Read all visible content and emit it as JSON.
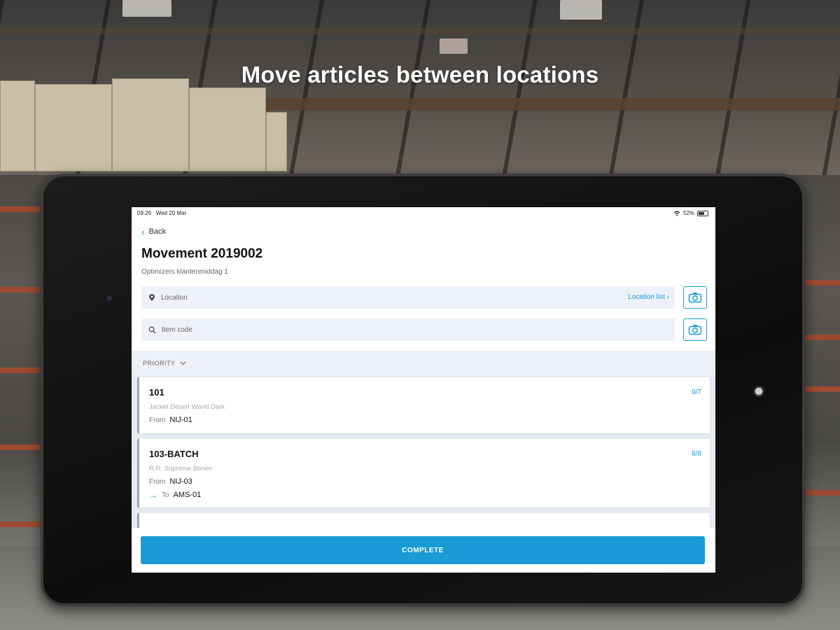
{
  "headline": "Move articles between locations",
  "status": {
    "time": "09:26",
    "date": "Wed 20 Mar",
    "battery": "52%"
  },
  "nav": {
    "back_label": "Back"
  },
  "movement": {
    "title": "Movement 2019002",
    "subtitle": "Optimizers klantenmiddag 1"
  },
  "location_field": {
    "placeholder": "Location",
    "link_label": "Location list"
  },
  "item_field": {
    "placeholder": "Item code"
  },
  "sort": {
    "label": "PRIORITY"
  },
  "items": [
    {
      "code": "101",
      "description": "Jacket Desert World Dark",
      "from_label": "From",
      "from": "NIJ-01",
      "count": "0/7"
    },
    {
      "code": "103-BATCH",
      "description": "R.R. Supreme Bonen",
      "from_label": "From",
      "from": "NIJ-03",
      "to_label": "To",
      "to": "AMS-01",
      "count": "8/8"
    }
  ],
  "actions": {
    "complete_label": "COMPLETE"
  },
  "colors": {
    "accent": "#1a9ad6",
    "field_bg": "#eef1f9",
    "list_bg": "#e7eaf3"
  }
}
